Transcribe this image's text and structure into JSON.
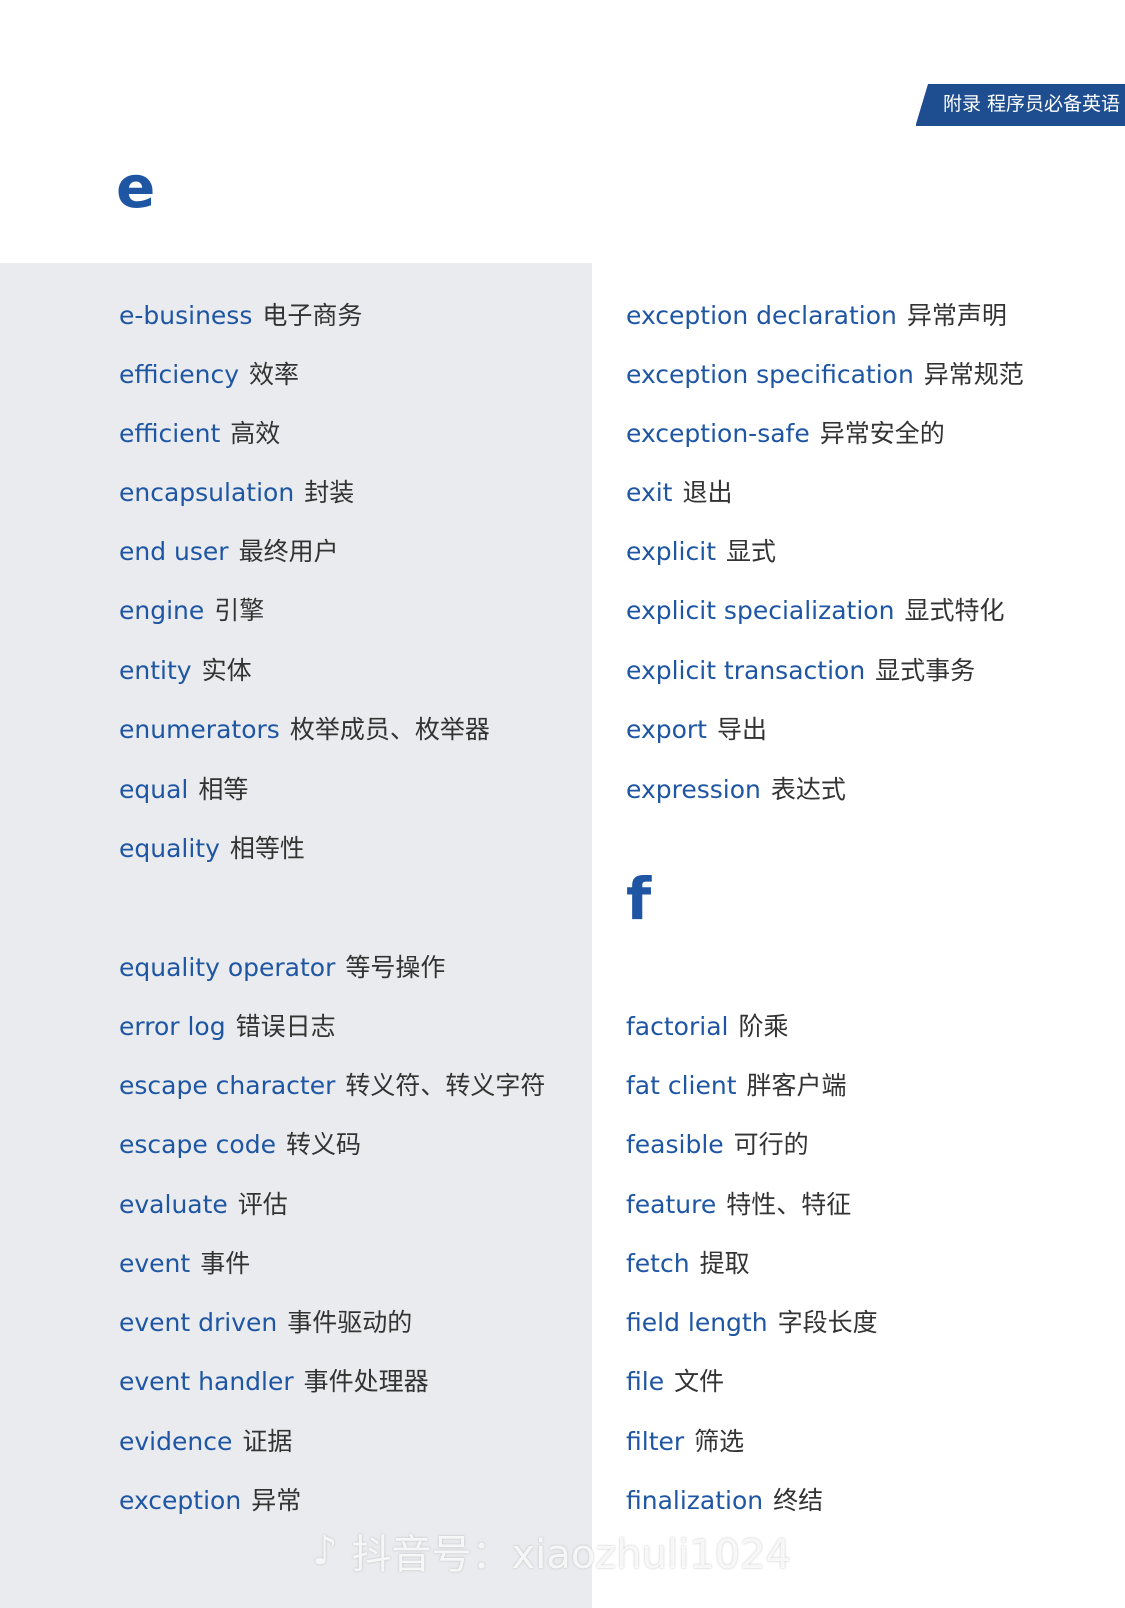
{
  "header": {
    "label": "附录 程序员必备英语"
  },
  "sections": {
    "e_letter": "e",
    "f_letter": "f"
  },
  "col_left": [
    {
      "term": "e-business",
      "gloss": "电子商务"
    },
    {
      "term": "efficiency",
      "gloss": "效率"
    },
    {
      "term": "efficient",
      "gloss": "高效"
    },
    {
      "term": "encapsulation",
      "gloss": "封装"
    },
    {
      "term": "end user",
      "gloss": "最终用户"
    },
    {
      "term": "engine",
      "gloss": "引擎"
    },
    {
      "term": "entity",
      "gloss": "实体"
    },
    {
      "term": "enumerators",
      "gloss": "枚举成员、枚举器"
    },
    {
      "term": "equal",
      "gloss": "相等"
    },
    {
      "term": "equality",
      "gloss": "相等性"
    },
    {
      "term": "equality operator",
      "gloss": "等号操作"
    },
    {
      "term": "error log",
      "gloss": "错误日志"
    },
    {
      "term": "escape character",
      "gloss": "转义符、转义字符"
    },
    {
      "term": "escape code",
      "gloss": "转义码"
    },
    {
      "term": "evaluate",
      "gloss": "评估"
    },
    {
      "term": "event",
      "gloss": "事件"
    },
    {
      "term": "event driven",
      "gloss": "事件驱动的"
    },
    {
      "term": "event handler",
      "gloss": "事件处理器"
    },
    {
      "term": "evidence",
      "gloss": "证据"
    },
    {
      "term": "exception",
      "gloss": "异常"
    }
  ],
  "col_right_e": [
    {
      "term": "exception declaration",
      "gloss": "异常声明"
    },
    {
      "term": "exception specification",
      "gloss": "异常规范"
    },
    {
      "term": "exception-safe",
      "gloss": "异常安全的"
    },
    {
      "term": "exit",
      "gloss": "退出"
    },
    {
      "term": "explicit",
      "gloss": "显式"
    },
    {
      "term": "explicit specialization",
      "gloss": "显式特化"
    },
    {
      "term": "explicit transaction",
      "gloss": "显式事务"
    },
    {
      "term": "export",
      "gloss": "导出"
    },
    {
      "term": "expression",
      "gloss": "表达式"
    }
  ],
  "col_right_f": [
    {
      "term": "factorial",
      "gloss": "阶乘"
    },
    {
      "term": "fat client",
      "gloss": "胖客户端"
    },
    {
      "term": "feasible",
      "gloss": "可行的"
    },
    {
      "term": "feature",
      "gloss": "特性、特征"
    },
    {
      "term": "fetch",
      "gloss": "提取"
    },
    {
      "term": "field length",
      "gloss": "字段长度"
    },
    {
      "term": "file",
      "gloss": "文件"
    },
    {
      "term": "filter",
      "gloss": "筛选"
    },
    {
      "term": "finalization",
      "gloss": "终结"
    }
  ],
  "watermark": {
    "text": "抖音号：xiaozhuli1024"
  }
}
